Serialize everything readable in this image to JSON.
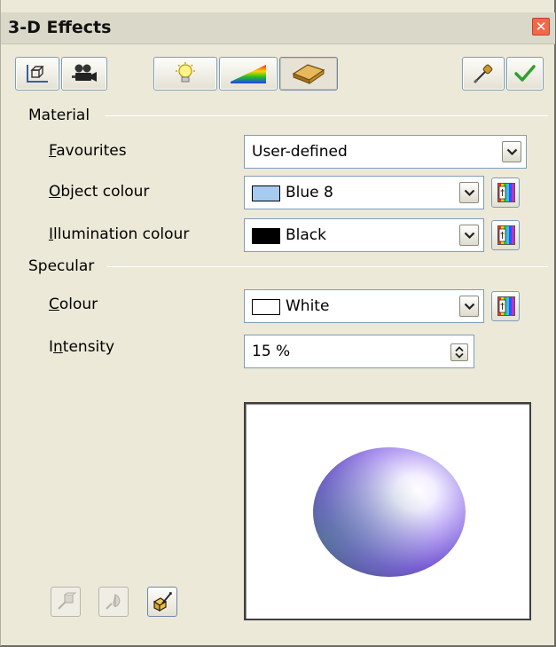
{
  "window": {
    "title": "3-D Effects",
    "close_label": "✕"
  },
  "toolbar": {
    "buttons": [
      {
        "name": "geometry",
        "icon": "cube-icon"
      },
      {
        "name": "shading",
        "icon": "camera-icon"
      },
      {
        "name": "illumination",
        "icon": "lightbulb-icon"
      },
      {
        "name": "textures",
        "icon": "rainbow-wedge-icon"
      },
      {
        "name": "material",
        "icon": "material-slab-icon",
        "active": true
      }
    ],
    "right_buttons": [
      {
        "name": "assign",
        "icon": "eyedropper-icon"
      },
      {
        "name": "update",
        "icon": "checkmark-icon"
      }
    ]
  },
  "material": {
    "section_label": "Material",
    "favourites": {
      "label_accel": "F",
      "label_rest": "avourites",
      "value": "User-defined"
    },
    "object_colour": {
      "label_accel": "O",
      "label_rest": "bject colour",
      "value": "Blue 8",
      "swatch": "#a6caf0"
    },
    "illumination_colour": {
      "label_accel": "I",
      "label_rest": "llumination colour",
      "value": "Black",
      "swatch": "#000000"
    }
  },
  "specular": {
    "section_label": "Specular",
    "colour": {
      "label_accel": "C",
      "label_rest": "olour",
      "value": "White",
      "swatch": "#ffffff"
    },
    "intensity": {
      "label_pre": "I",
      "label_accel": "n",
      "label_rest": "tensity",
      "value": "15 %"
    }
  },
  "preview": {
    "sphere_colors": [
      "#ffffff",
      "#b9a6f2",
      "#7a5cd6",
      "#4f8f8a"
    ]
  },
  "bottom_buttons": [
    {
      "name": "convert-to-3d",
      "icon": "convert-3d-icon",
      "enabled": false
    },
    {
      "name": "convert-to-lathe",
      "icon": "lathe-object-icon",
      "enabled": false
    },
    {
      "name": "perspective",
      "icon": "perspective-icon",
      "enabled": true
    }
  ]
}
